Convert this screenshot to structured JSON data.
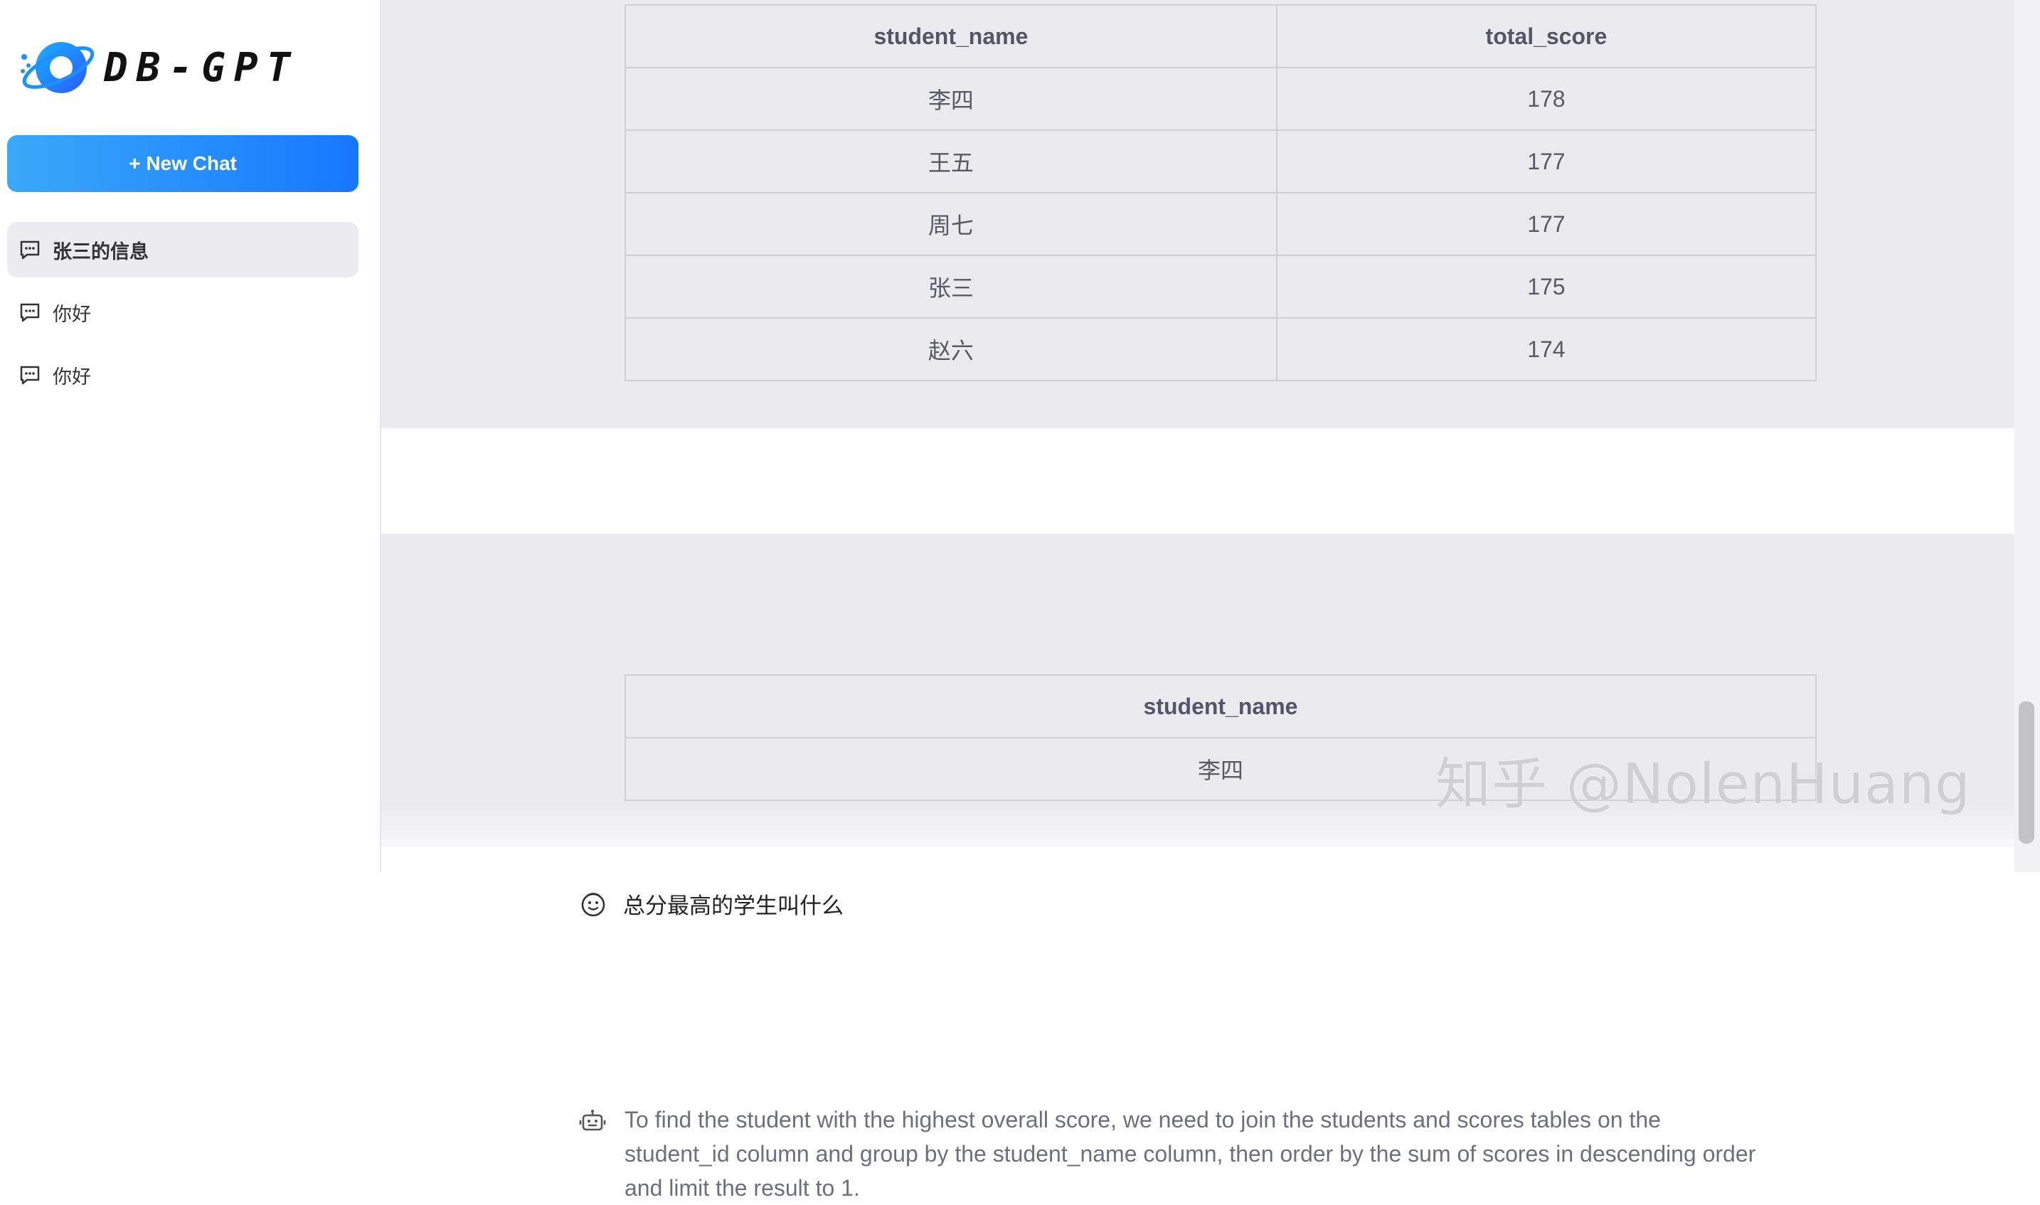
{
  "app": {
    "logo_text": "DB-GPT"
  },
  "sidebar": {
    "new_chat_label": "+ New Chat",
    "conversations": [
      {
        "label": "张三的信息",
        "active": true
      },
      {
        "label": "你好",
        "active": false
      },
      {
        "label": "你好",
        "active": false
      }
    ]
  },
  "chat": {
    "table1": {
      "headers": [
        "student_name",
        "total_score"
      ],
      "rows": [
        [
          "李四",
          "178"
        ],
        [
          "王五",
          "177"
        ],
        [
          "周七",
          "177"
        ],
        [
          "张三",
          "175"
        ],
        [
          "赵六",
          "174"
        ]
      ]
    },
    "user_message": "总分最高的学生叫什么",
    "bot_message": "To find the student with the highest overall score, we need to join the students and scores tables on the student_id column and group by the student_name column, then order by the sum of scores in descending order and limit the result to 1.",
    "table2": {
      "headers": [
        "student_name"
      ],
      "rows": [
        [
          "李四"
        ]
      ]
    }
  },
  "watermark": "知乎 @NolenHuang",
  "colors": {
    "accent": "#1677ff",
    "gradient_start": "#3aa9f8",
    "panel_gray": "#ebebef"
  },
  "icons": {
    "conversation": "message-square-icon",
    "user": "smiley-face-icon",
    "bot": "robot-icon",
    "logo": "planet-logo-icon"
  }
}
